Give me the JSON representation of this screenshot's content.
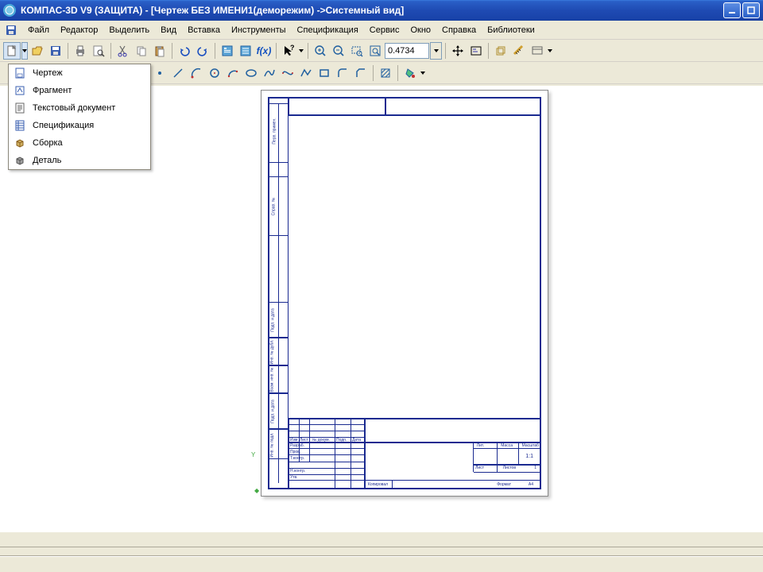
{
  "title": "КОМПАС-3D V9 (ЗАЩИТА) - [Чертеж БЕЗ ИМЕНИ1(деморежим) ->Системный вид]",
  "menubar": {
    "items": [
      "Файл",
      "Редактор",
      "Выделить",
      "Вид",
      "Вставка",
      "Инструменты",
      "Спецификация",
      "Сервис",
      "Окно",
      "Справка",
      "Библиотеки"
    ]
  },
  "toolbar": {
    "zoom_value": "0.4734"
  },
  "dropdown": {
    "items": [
      {
        "icon": "drawing-icon",
        "label": "Чертеж"
      },
      {
        "icon": "fragment-icon",
        "label": "Фрагмент"
      },
      {
        "icon": "text-doc-icon",
        "label": "Текстовый документ"
      },
      {
        "icon": "spec-icon",
        "label": "Спецификация"
      },
      {
        "icon": "assembly-icon",
        "label": "Сборка"
      },
      {
        "icon": "part-icon",
        "label": "Деталь"
      }
    ]
  },
  "titleblock": {
    "col_izm": "Изм.",
    "col_list": "Лист",
    "col_doc": "№ докум.",
    "col_sign": "Подп.",
    "col_date": "Дата",
    "row_razrab": "Разраб.",
    "row_prov": "Пров.",
    "row_tcontr": "Т.контр.",
    "row_ncontr": "Н.контр.",
    "row_utv": "Утв.",
    "lit": "Лит.",
    "massa": "Масса",
    "mashtab": "Масштаб",
    "scale": "1:1",
    "list": "Лист",
    "listov": "Листов",
    "listov_val": "1",
    "kopiroval": "Копировал",
    "format": "Формат",
    "format_val": "A4"
  },
  "sidecol": {
    "perv": "Перв. примен.",
    "sprav": "Справ. №",
    "podp_data": "Подп. и дата",
    "inv_dubl": "Инв. № дубл.",
    "vzam": "Взам. инв. №",
    "podp_data2": "Подп. и дата",
    "inv_podl": "Инв. № подл."
  }
}
